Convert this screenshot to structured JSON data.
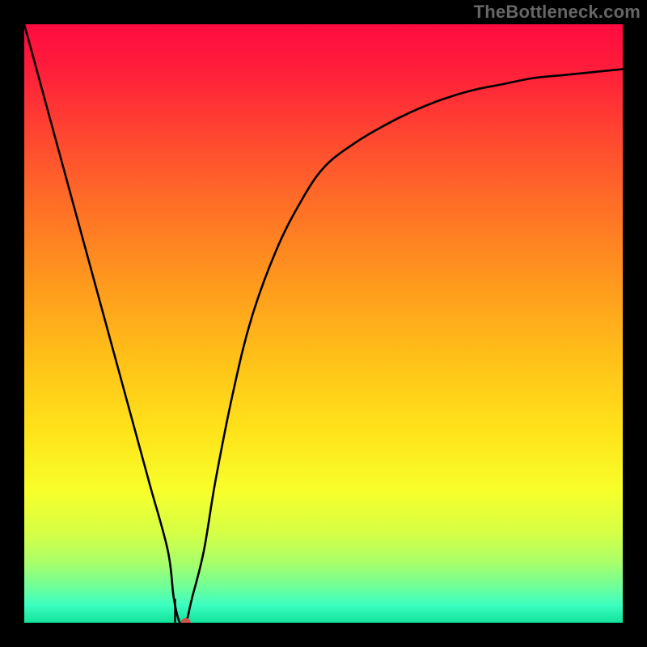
{
  "watermark": "TheBottleneck.com",
  "chart_data": {
    "type": "line",
    "title": "",
    "xlabel": "",
    "ylabel": "",
    "xlim": [
      0,
      100
    ],
    "ylim": [
      0,
      100
    ],
    "legend": false,
    "background": "rainbow-gradient",
    "gradient_stops": [
      {
        "offset": 0.0,
        "color": "#ff0b3f"
      },
      {
        "offset": 0.07,
        "color": "#ff1c3b"
      },
      {
        "offset": 0.18,
        "color": "#ff4431"
      },
      {
        "offset": 0.3,
        "color": "#ff6e27"
      },
      {
        "offset": 0.42,
        "color": "#ff951e"
      },
      {
        "offset": 0.55,
        "color": "#ffbe18"
      },
      {
        "offset": 0.68,
        "color": "#ffe31a"
      },
      {
        "offset": 0.78,
        "color": "#f7ff2a"
      },
      {
        "offset": 0.85,
        "color": "#d6ff45"
      },
      {
        "offset": 0.9,
        "color": "#a8ff6a"
      },
      {
        "offset": 0.94,
        "color": "#6fff9a"
      },
      {
        "offset": 0.97,
        "color": "#3cffc0"
      },
      {
        "offset": 1.0,
        "color": "#12e29c"
      }
    ],
    "series": [
      {
        "name": "curve",
        "color": "#000000",
        "x": [
          0,
          3,
          6,
          9,
          12,
          15,
          18,
          21,
          24,
          25,
          26,
          27,
          28,
          30,
          32,
          35,
          38,
          42,
          46,
          50,
          55,
          60,
          65,
          70,
          75,
          80,
          85,
          90,
          95,
          100
        ],
        "y": [
          100,
          89,
          78,
          67,
          56,
          45,
          34,
          23,
          12,
          4,
          0,
          0,
          4,
          12,
          24,
          39,
          51,
          62,
          70,
          76,
          80,
          83,
          85.5,
          87.5,
          89,
          90,
          91,
          91.5,
          92,
          92.5
        ]
      }
    ],
    "marker": {
      "x": 27,
      "y": 0,
      "color": "#d1524c",
      "radius_px": 6
    },
    "notch": {
      "x": 25.2,
      "depth_pct": 4
    }
  }
}
